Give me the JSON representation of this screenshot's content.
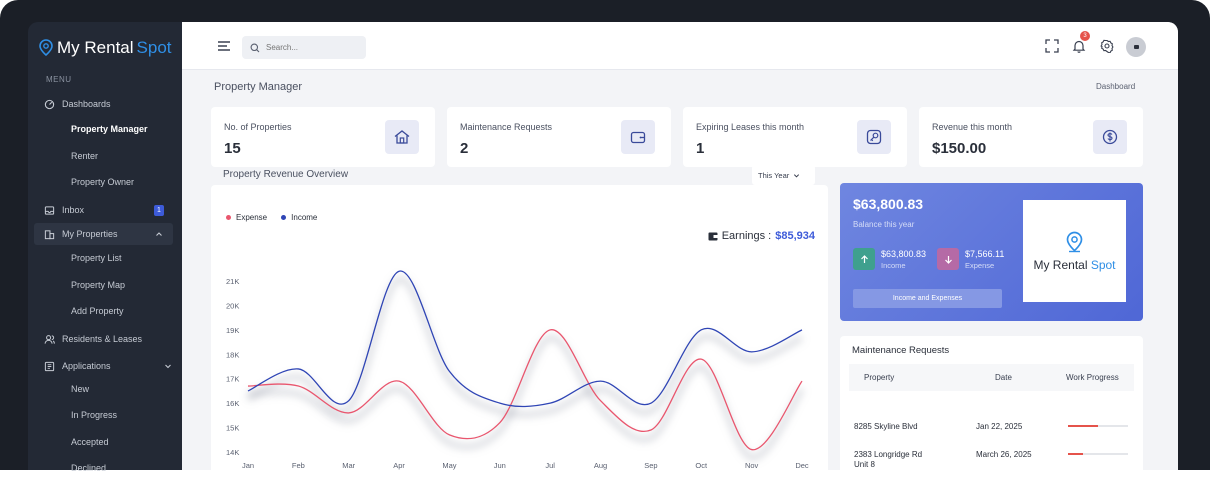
{
  "app": {
    "name_main": "My Rental",
    "name_accent": " Spot"
  },
  "sidebar": {
    "menu_heading": "MENU",
    "items": [
      {
        "label": "Dashboards",
        "icon": "dashboard-icon"
      },
      {
        "label": "Property Manager",
        "sub": true,
        "active": true
      },
      {
        "label": "Renter",
        "sub": true
      },
      {
        "label": "Property Owner",
        "sub": true
      },
      {
        "label": "Inbox",
        "icon": "inbox-icon",
        "badge": "1"
      },
      {
        "label": "My Properties",
        "icon": "building-icon",
        "open": true
      },
      {
        "label": "Property List",
        "sub": true
      },
      {
        "label": "Property Map",
        "sub": true
      },
      {
        "label": "Add Property",
        "sub": true
      },
      {
        "label": "Residents & Leases",
        "icon": "users-icon"
      },
      {
        "label": "Applications",
        "icon": "applications-icon"
      },
      {
        "label": "New",
        "sub": true
      },
      {
        "label": "In Progress",
        "sub": true
      },
      {
        "label": "Accepted",
        "sub": true
      },
      {
        "label": "Declined",
        "sub": true
      }
    ]
  },
  "topbar": {
    "search_placeholder": "Search...",
    "notification_count": "3"
  },
  "page": {
    "title": "Property Manager",
    "breadcrumb": "Dashboard"
  },
  "stats": [
    {
      "title": "No. of Properties",
      "value": "15",
      "icon": "house-icon"
    },
    {
      "title": "Maintenance Requests",
      "value": "2",
      "icon": "wallet-icon"
    },
    {
      "title": "Expiring Leases this month",
      "value": "1",
      "icon": "key-icon"
    },
    {
      "title": "Revenue this month",
      "value": "$150.00",
      "icon": "dollar-icon"
    }
  ],
  "chart_section": {
    "title": "Property Revenue Overview",
    "period": "This Year",
    "earnings_label": "Earnings :",
    "earnings_value": "$85,934"
  },
  "chart_data": {
    "type": "line",
    "title": "Property Revenue Overview",
    "categories": [
      "Jan",
      "Feb",
      "Mar",
      "Apr",
      "May",
      "Jun",
      "Jul",
      "Aug",
      "Sep",
      "Oct",
      "Nov",
      "Dec"
    ],
    "y_ticks": [
      "21K",
      "20K",
      "19K",
      "18K",
      "17K",
      "16K",
      "15K",
      "14K"
    ],
    "ylim": [
      14000,
      21000
    ],
    "legend_position": "top-left",
    "series": [
      {
        "name": "Expense",
        "color": "#e9566e",
        "values": [
          16700,
          16700,
          15600,
          16900,
          14700,
          15200,
          19000,
          16100,
          14900,
          17800,
          14100,
          16900
        ]
      },
      {
        "name": "Income",
        "color": "#2f45b5",
        "values": [
          16500,
          17400,
          16100,
          21400,
          17300,
          16000,
          16000,
          16900,
          16000,
          19000,
          18100,
          19000
        ]
      }
    ]
  },
  "balance": {
    "amount": "$63,800.83",
    "caption": "Balance this year",
    "income_value": "$63,800.83",
    "income_label": "Income",
    "expense_value": "$7,566.11",
    "expense_label": "Expense",
    "button": "Income and Expenses",
    "income_color": "#3fa08e",
    "expense_color": "#b56aa6"
  },
  "maintenance": {
    "title": "Maintenance Requests",
    "columns": [
      "Property",
      "Date",
      "Work Progress"
    ],
    "rows": [
      {
        "property": "8285 Skyline Blvd",
        "property_line2": "",
        "date": "Jan 22, 2025",
        "progress": 0.5
      },
      {
        "property": "2383 Longridge Rd",
        "property_line2": "Unit 8",
        "date": "March 26, 2025",
        "progress": 0.25
      }
    ]
  }
}
